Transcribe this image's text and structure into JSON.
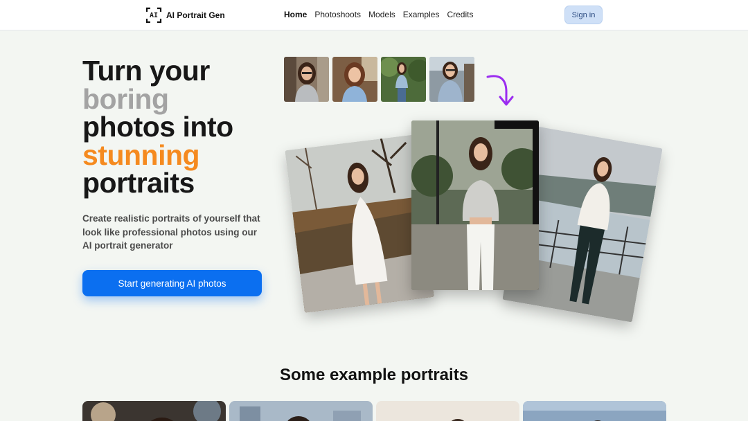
{
  "header": {
    "logo_icon": "ai-bracket-logo-icon",
    "logo_mark": "AI",
    "brand": "AI Portrait Gen",
    "nav": [
      {
        "label": "Home",
        "active": true
      },
      {
        "label": "Photoshoots",
        "active": false
      },
      {
        "label": "Models",
        "active": false
      },
      {
        "label": "Examples",
        "active": false
      },
      {
        "label": "Credits",
        "active": false
      }
    ],
    "signin_label": "Sign in"
  },
  "hero": {
    "headline": {
      "line1": "Turn your",
      "line2": "boring",
      "line3": "photos into",
      "line4": "stunning",
      "line5": "portraits"
    },
    "subtext": "Create realistic portraits of yourself that look like professional photos using our AI portrait generator",
    "cta_label": "Start generating AI photos",
    "arrow_icon": "curved-arrow-down-icon",
    "colors": {
      "accent_orange": "#f58a1f",
      "muted_gray": "#a3a3a3",
      "cta_blue": "#0b6ff0",
      "arrow_purple": "#9b2df0"
    }
  },
  "examples": {
    "title": "Some example portraits"
  }
}
